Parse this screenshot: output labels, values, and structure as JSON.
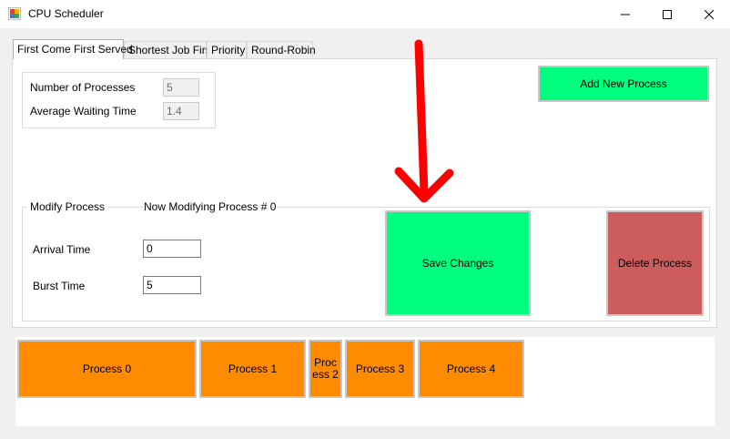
{
  "window": {
    "title": "CPU Scheduler",
    "controls": {
      "minimize": "—",
      "maximize": "☐",
      "close": "✕"
    }
  },
  "tabs": [
    {
      "label": "First Come First Served",
      "active": true
    },
    {
      "label": "Shortest Job First",
      "active": false
    },
    {
      "label": "Priority",
      "active": false
    },
    {
      "label": "Round-Robin",
      "active": false
    }
  ],
  "stats": {
    "num_processes_label": "Number of Processes",
    "num_processes_value": "5",
    "avg_wait_label": "Average Waiting Time",
    "avg_wait_value": "1.4"
  },
  "add_button_label": "Add New Process",
  "modify": {
    "group_label": "Modify Process",
    "now_modifying": "Now Modifying Process # 0",
    "arrival_label": "Arrival Time",
    "arrival_value": "0",
    "burst_label": "Burst Time",
    "burst_value": "5",
    "save_label": "Save Changes",
    "delete_label": "Delete Process"
  },
  "processes": [
    {
      "label": "Process 0"
    },
    {
      "label": "Process 1"
    },
    {
      "label": "Proc\ness 2"
    },
    {
      "label": "Process 3"
    },
    {
      "label": "Process 4"
    }
  ],
  "colors": {
    "accent_green": "#00ff7f",
    "delete_red": "#cd5c5c",
    "process_orange": "#ff8c00",
    "annotation_arrow": "#ff0000"
  }
}
